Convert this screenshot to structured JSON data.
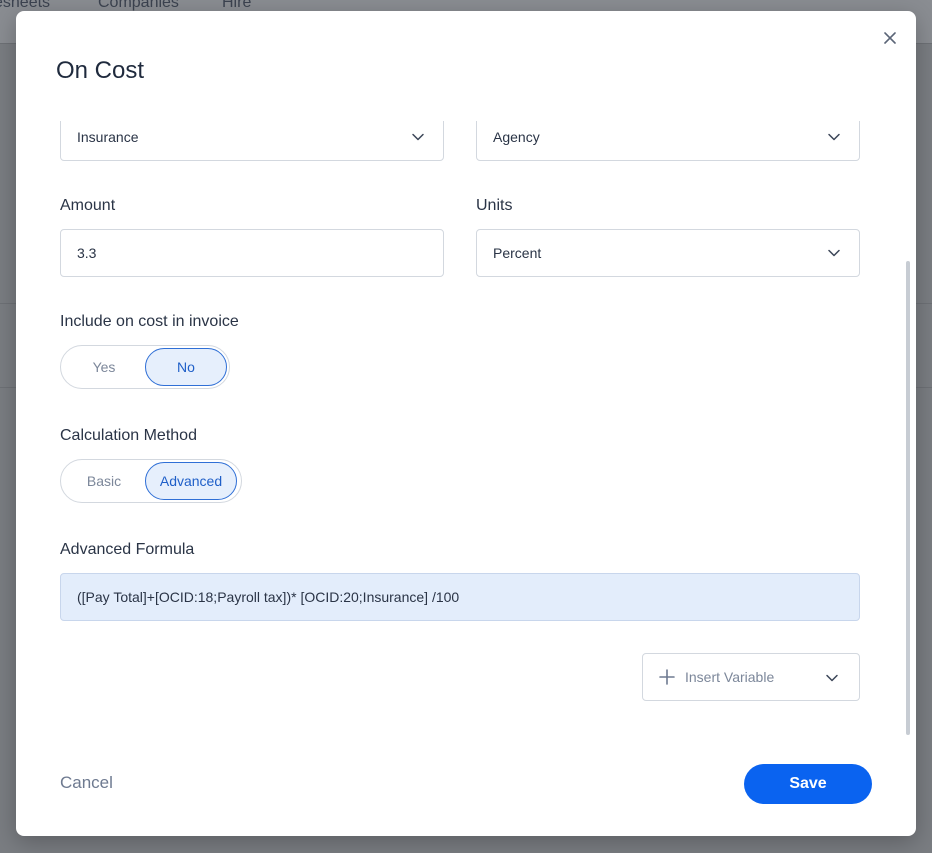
{
  "background": {
    "nav_items": [
      "esheets",
      "Companies",
      "Hire"
    ]
  },
  "modal": {
    "title": "On Cost",
    "close_icon": "close-icon"
  },
  "fields": {
    "oncost_type": {
      "value": "Insurance"
    },
    "applies_to": {
      "value": "Agency"
    },
    "amount": {
      "label": "Amount",
      "value": "3.3"
    },
    "units": {
      "label": "Units",
      "value": "Percent"
    },
    "include_in_invoice": {
      "label": "Include on cost in invoice",
      "options": [
        "Yes",
        "No"
      ],
      "selected": "No"
    },
    "calculation_method": {
      "label": "Calculation Method",
      "options": [
        "Basic",
        "Advanced"
      ],
      "selected": "Advanced"
    },
    "advanced_formula": {
      "label": "Advanced Formula",
      "value": "([Pay Total]+[OCID:18;Payroll tax])* [OCID:20;Insurance] /100"
    },
    "insert_variable": {
      "label": "Insert Variable"
    }
  },
  "footer": {
    "cancel_label": "Cancel",
    "save_label": "Save"
  },
  "colors": {
    "primary": "#0a63f0",
    "toggle_active_bg": "#e6effc",
    "formula_bg": "#e3edfb"
  }
}
